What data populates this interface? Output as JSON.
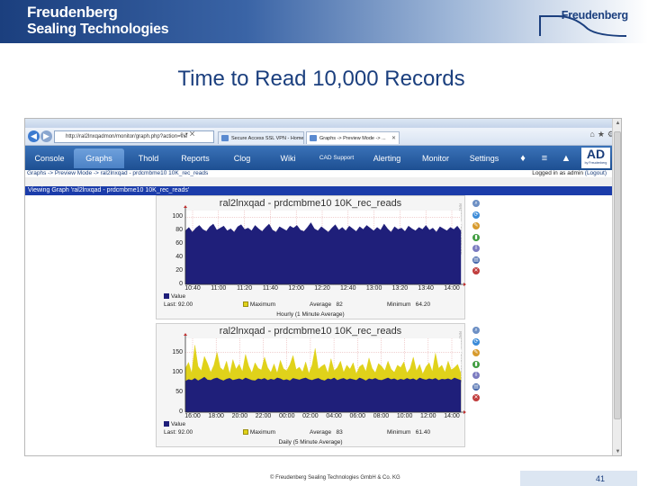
{
  "header": {
    "brand_line1": "Freudenberg",
    "brand_line2": "Sealing Technologies",
    "logo_text": "Freudenberg"
  },
  "slide_title": "Time to Read 10,000 Records",
  "browser": {
    "url": "http://ral2lnxqadmon/monitor/graph.php?action=vie",
    "tabs": [
      {
        "label": "Secure Access SSL VPN - Home",
        "active": false
      },
      {
        "label": "Graphs -> Preview Mode -> ...",
        "active": true
      }
    ]
  },
  "app_nav": {
    "tabs": [
      {
        "label": "Console",
        "active": false
      },
      {
        "label": "Graphs",
        "active": true
      },
      {
        "label": "Thold",
        "active": false
      },
      {
        "label": "Reports",
        "active": false
      },
      {
        "label": "Clog",
        "active": false
      },
      {
        "label": "Wiki",
        "active": false
      },
      {
        "label": "CAD Support",
        "active": false
      },
      {
        "label": "Alerting",
        "active": false
      },
      {
        "label": "Monitor",
        "active": false
      },
      {
        "label": "Settings",
        "active": false
      }
    ],
    "logo": "AD",
    "logo_sub": "by Freudenberg"
  },
  "breadcrumb": "Graphs -> Preview Mode -> ral2lnxqad - prdcmbme10 10K_rec_reads",
  "login": {
    "prefix": "Logged in as",
    "user": "admin",
    "logout": "(Logout)"
  },
  "viewing_bar": "Viewing Graph 'ral2lnxqad - prdcmbme10 10K_rec_reads'",
  "graphs": [
    {
      "title": "ral2lnxqad - prdcmbme10 10K_rec_reads",
      "side_label": "RRDTOOL / TOBI OETIKER",
      "legend_value": "Value",
      "legend_max": "Maximum",
      "last_label": "Last:",
      "last": "92.00",
      "average_label": "Average",
      "average": "82",
      "minimum_label": "Minimum",
      "minimum": "64.20",
      "caption": "Hourly (1 Minute Average)"
    },
    {
      "title": "ral2lnxqad - prdcmbme10 10K_rec_reads",
      "side_label": "RRDTOOL / TOBI OETIKER",
      "legend_value": "Value",
      "legend_max": "Maximum",
      "last_label": "Last:",
      "last": "92.00",
      "average_label": "Average",
      "average": "83",
      "minimum_label": "Minimum",
      "minimum": "61.40",
      "caption": "Daily (5 Minute Average)"
    }
  ],
  "chart_data": [
    {
      "type": "area",
      "title": "ral2lnxqad - prdcmbme10 10K_rec_reads",
      "xlabel": "",
      "ylabel": "",
      "x": [
        "10:40",
        "11:00",
        "11:20",
        "11:40",
        "12:00",
        "12:20",
        "12:40",
        "13:00",
        "13:20",
        "13:40",
        "14:00"
      ],
      "yticks": [
        0,
        20,
        40,
        60,
        80,
        100
      ],
      "ylim": [
        0,
        110
      ],
      "series": [
        {
          "name": "Value",
          "color": "#1f1f7a",
          "values": [
            80,
            85,
            78,
            84,
            88,
            82,
            79,
            86,
            90,
            81,
            84,
            87,
            80,
            83,
            78,
            86,
            89,
            82,
            84,
            80,
            88,
            83,
            79,
            85,
            90,
            81,
            78,
            86,
            83,
            80,
            87,
            84,
            88,
            81,
            79,
            85,
            92,
            83,
            80,
            86,
            82,
            78,
            84,
            89,
            81,
            85,
            80,
            87,
            83,
            79,
            86,
            82,
            88,
            84,
            80,
            85,
            81,
            90,
            83,
            78,
            86,
            82,
            84,
            79,
            87,
            83,
            80,
            85,
            82,
            88,
            81,
            84,
            78,
            86,
            83,
            80,
            85,
            82,
            87,
            80
          ]
        },
        {
          "name": "Maximum",
          "color": "#e0d21a",
          "values": []
        }
      ]
    },
    {
      "type": "area",
      "title": "ral2lnxqad - prdcmbme10 10K_rec_reads",
      "xlabel": "",
      "ylabel": "",
      "x": [
        "16:00",
        "18:00",
        "20:00",
        "22:00",
        "00:00",
        "02:00",
        "04:00",
        "06:00",
        "08:00",
        "10:00",
        "12:00",
        "14:00"
      ],
      "yticks": [
        0,
        50,
        100,
        150
      ],
      "ylim": [
        0,
        185
      ],
      "series": [
        {
          "name": "Value",
          "color": "#1f1f7a",
          "values": [
            78,
            82,
            80,
            85,
            79,
            83,
            88,
            81,
            80,
            84,
            86,
            82,
            79,
            83,
            85,
            80,
            82,
            84,
            81,
            86,
            83,
            80,
            79,
            84,
            82,
            85,
            80,
            83,
            81,
            86,
            84,
            80,
            82,
            79,
            85,
            83,
            81,
            84,
            86,
            82,
            80,
            83,
            85,
            81,
            79,
            84,
            82,
            86,
            80,
            83,
            85,
            81,
            84,
            82,
            80,
            86,
            83,
            79,
            84,
            82,
            85,
            81,
            80,
            83,
            86,
            82,
            84,
            80,
            83,
            81,
            85,
            82,
            84,
            80,
            86,
            83,
            81,
            84,
            82,
            85,
            80,
            83,
            82,
            84,
            81,
            86,
            83,
            80
          ]
        },
        {
          "name": "Maximum",
          "color": "#e0d21a",
          "values": [
            110,
            125,
            98,
            168,
            115,
            104,
            140,
            122,
            100,
            118,
            150,
            112,
            105,
            128,
            96,
            132,
            108,
            120,
            102,
            145,
            116,
            99,
            124,
            110,
            106,
            138,
            112,
            100,
            121,
            98,
            130,
            109,
            104,
            119,
            142,
            107,
            113,
            101,
            126,
            97,
            118,
            160,
            108,
            115,
            120,
            98,
            134,
            104,
            112,
            128,
            100,
            118,
            108,
            124,
            96,
            114,
            120,
            102,
            136,
            110,
            99,
            122,
            115,
            104,
            128,
            108,
            100,
            118,
            112,
            126,
            98,
            110,
            138,
            104,
            120,
            96,
            114,
            124,
            102,
            148,
            110,
            118,
            100,
            128,
            106,
            112,
            120,
            98
          ]
        }
      ]
    }
  ],
  "footer": {
    "copyright": "© Freudenberg Sealing Technologies GmbH & Co. KG",
    "page_number": "41"
  },
  "colors": {
    "slide_title": "#1b3f7e",
    "nav_bg": "#1d4f92",
    "viewing_bar": "#1b3caa",
    "series_value": "#1f1f7a",
    "series_max": "#e0d21a"
  }
}
